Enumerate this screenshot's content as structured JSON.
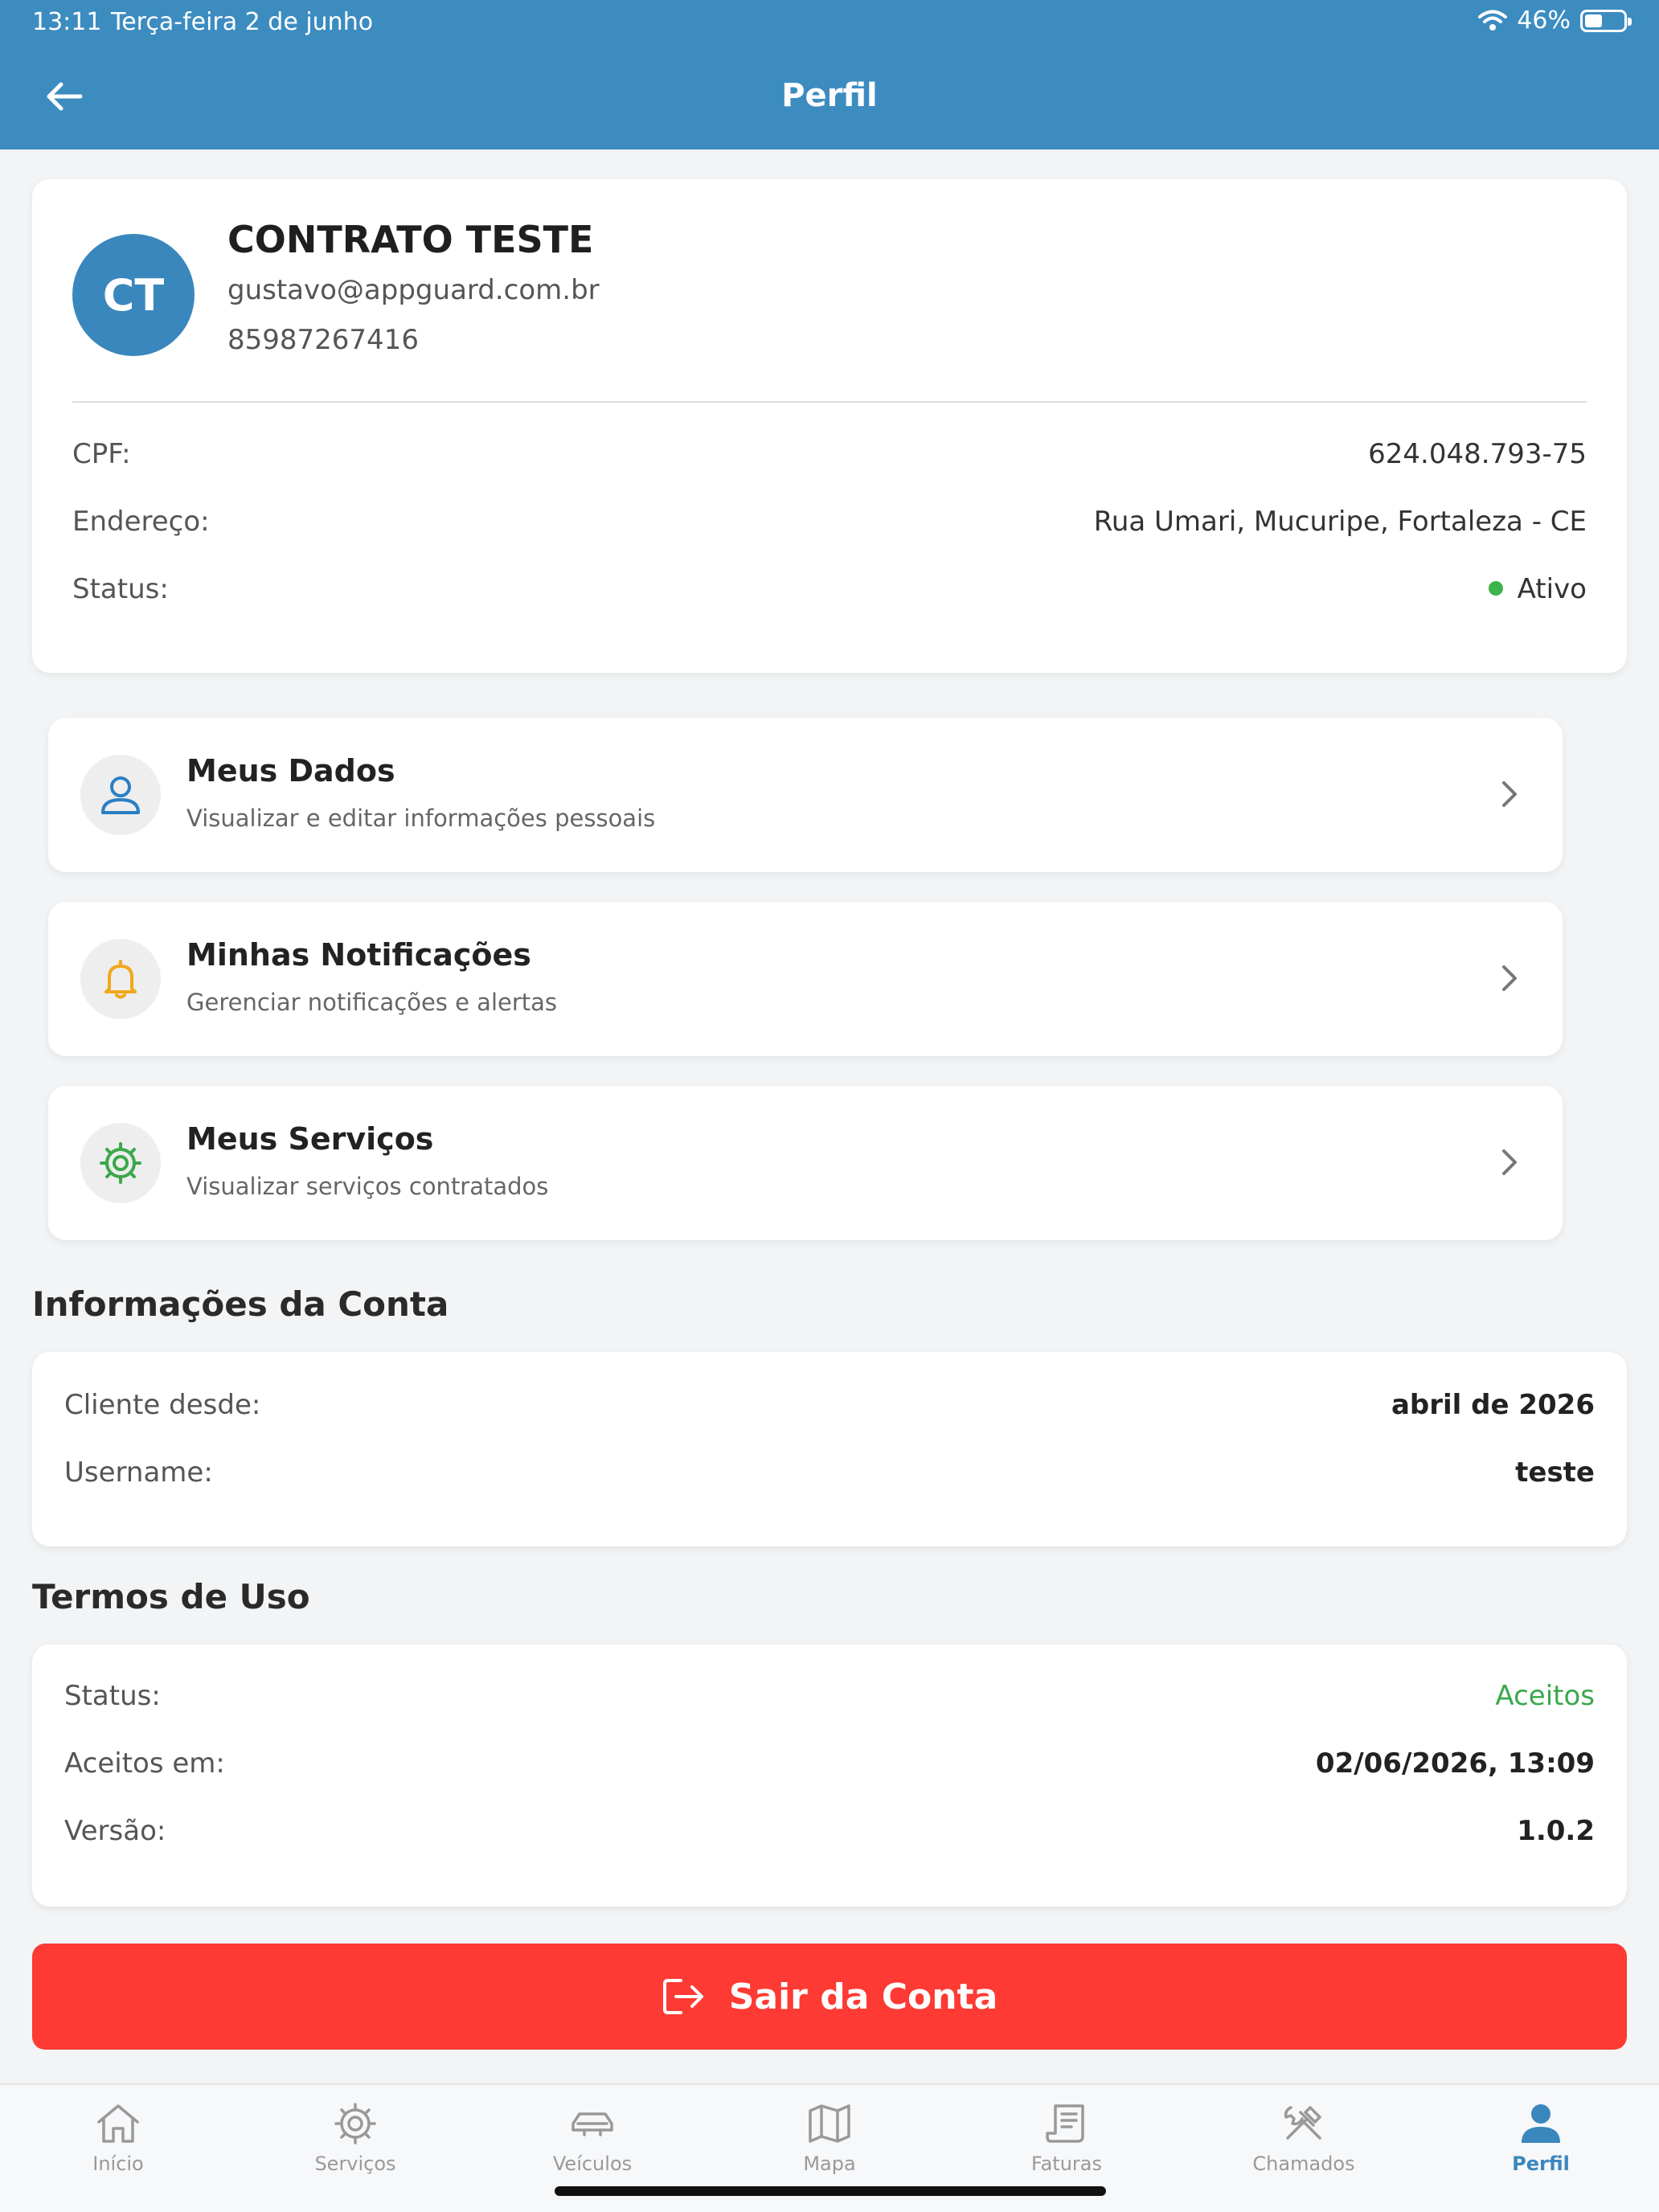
{
  "status_bar": {
    "time": "13:11",
    "date": "Terça-feira 2 de junho",
    "battery": "46%",
    "battery_level": 0.46
  },
  "header": {
    "title": "Perfil",
    "back_icon": "arrow-left-icon"
  },
  "profile": {
    "initials": "CT",
    "name": "CONTRATO TESTE",
    "email": "gustavo@appguard.com.br",
    "phone": "85987267416",
    "rows": [
      {
        "label": "CPF:",
        "value": "624.048.793-75"
      },
      {
        "label": "Endereço:",
        "value": "Rua Umari, Mucuripe, Fortaleza - CE"
      },
      {
        "label": "Status:",
        "value": "Ativo",
        "status_color": "#3cb44b"
      }
    ]
  },
  "menu": [
    {
      "title": "Meus Dados",
      "subtitle": "Visualizar e editar informações pessoais",
      "icon": "user-icon",
      "color": "#2a7fc4"
    },
    {
      "title": "Minhas Notificações",
      "subtitle": "Gerenciar notificações e alertas",
      "icon": "bell-icon",
      "color": "#f0a81c"
    },
    {
      "title": "Meus Serviços",
      "subtitle": "Visualizar serviços contratados",
      "icon": "gear-icon",
      "color": "#3aa84b"
    }
  ],
  "account": {
    "title": "Informações da Conta",
    "rows": [
      {
        "label": "Cliente desde:",
        "value": "abril de 2026"
      },
      {
        "label": "Username:",
        "value": "teste"
      }
    ]
  },
  "terms": {
    "title": "Termos de Uso",
    "rows": [
      {
        "label": "Status:",
        "value": "Aceitos"
      },
      {
        "label": "Aceitos em:",
        "value": "02/06/2026, 13:09"
      },
      {
        "label": "Versão:",
        "value": "1.0.2"
      }
    ]
  },
  "logout": {
    "label": "Sair da Conta",
    "icon": "logout-icon",
    "color": "#fd3a33"
  },
  "tabs": [
    {
      "label": "Início",
      "icon": "home-icon"
    },
    {
      "label": "Serviços",
      "icon": "gear-icon"
    },
    {
      "label": "Veículos",
      "icon": "car-icon"
    },
    {
      "label": "Mapa",
      "icon": "map-icon"
    },
    {
      "label": "Faturas",
      "icon": "receipt-icon"
    },
    {
      "label": "Chamados",
      "icon": "tools-icon"
    },
    {
      "label": "Perfil",
      "icon": "person-icon",
      "active": true
    }
  ],
  "colors": {
    "header": "#3c8cc0",
    "accent": "#3a87bd",
    "success": "#3aa84b"
  }
}
